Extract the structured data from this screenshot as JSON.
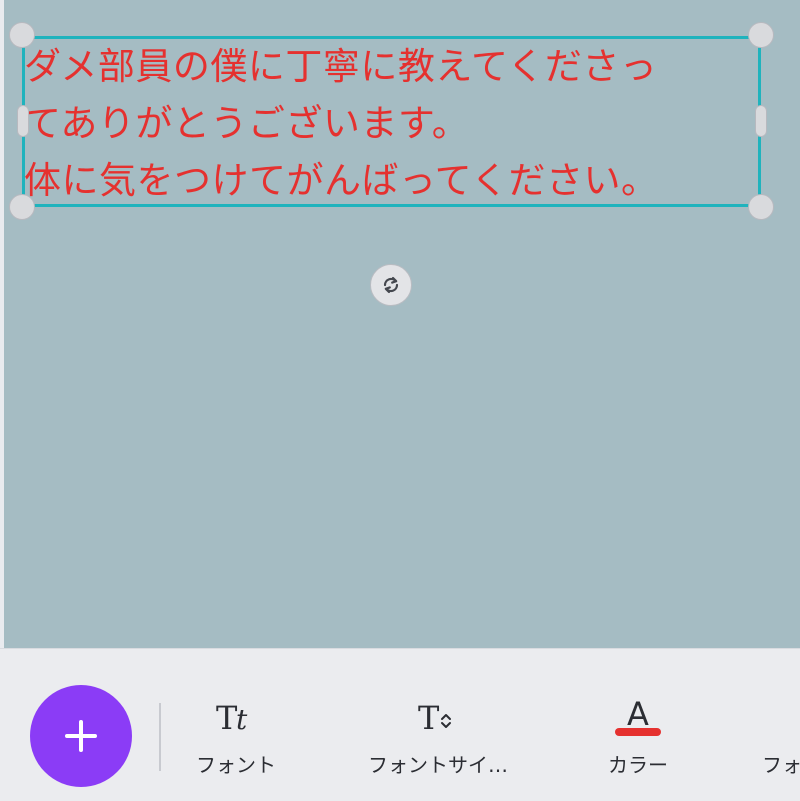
{
  "text_block": {
    "lines": [
      "ダメ部員の僕に丁寧に教えてくださっ",
      "てありがとうございます。",
      "体に気をつけてがんばってください。"
    ],
    "color": "#e5312f"
  },
  "selection": {
    "border_color": "#1fb3bd"
  },
  "toolbar": {
    "add_icon": "plus-icon",
    "add_color": "#8b3cf6",
    "tools": [
      {
        "icon": "font-icon",
        "label": "フォント"
      },
      {
        "icon": "font-size-icon",
        "label": "フォントサイ…"
      },
      {
        "icon": "text-color-icon",
        "label": "カラー"
      },
      {
        "label": "フォ"
      }
    ]
  }
}
